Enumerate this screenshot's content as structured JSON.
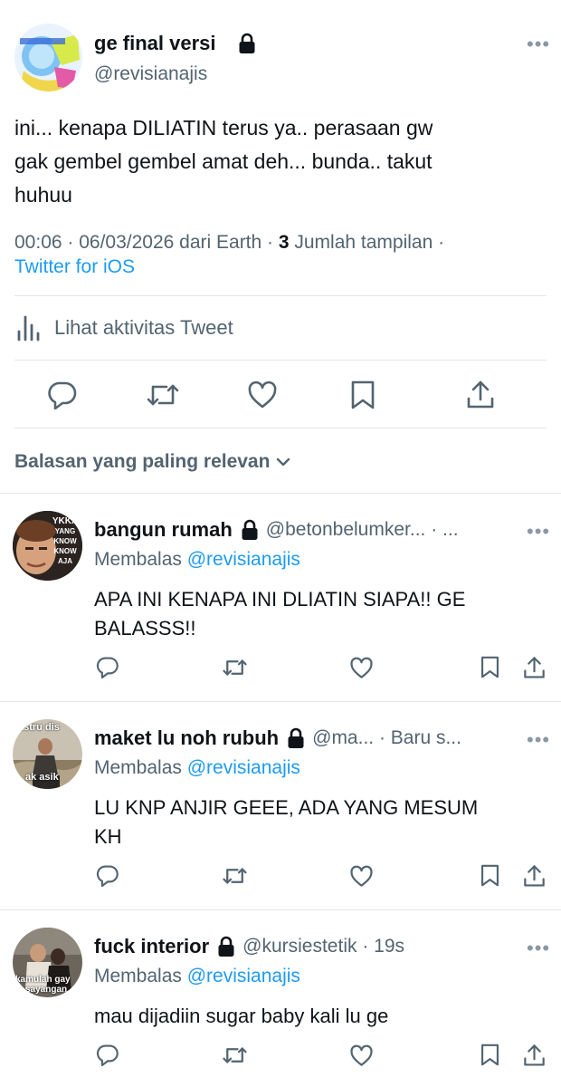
{
  "tweet": {
    "author_name": "ge final versi",
    "author_handle": "@revisianajis",
    "text_lines": [
      "ini... kenapa DILIATIN terus ya.. perasaan gw",
      "gak gembel gembel amat deh... bunda.. takut",
      "huhuu"
    ],
    "meta_time": "00:06 · 06/03/2026 dari Earth · ",
    "views_count": "3",
    "views_label": " Jumlah tampilan ·",
    "source": "Twitter for iOS",
    "activity_label": "Lihat aktivitas Tweet"
  },
  "sort": {
    "label": "Balasan yang paling relevan"
  },
  "replies": [
    {
      "name": "bangun rumah",
      "handle_time": "@betonbelumker... · ...",
      "replying_prefix": "Membalas",
      "replying_to": "@revisianajis",
      "text_lines": [
        "APA INI KENAPA INI DLIATIN SIAPA!! GE",
        "BALASSS!!"
      ],
      "avatar_text": [
        "YKKA",
        "YANG",
        "KNOW",
        "KNOW",
        "AJA"
      ]
    },
    {
      "name": "maket lu noh rubuh",
      "handle_time": "@ma... · Baru s...",
      "replying_prefix": "Membalas",
      "replying_to": "@revisianajis",
      "text_lines": [
        "LU KNP ANJIR GEEE, ADA YANG MESUM",
        "KH"
      ],
      "avatar_text": [
        "astru dis",
        "ak asik"
      ]
    },
    {
      "name": "fuck interior",
      "handle_time": "@kursiestetik · 19s",
      "replying_prefix": "Membalas",
      "replying_to": "@revisianajis",
      "text_lines": [
        "mau dijadiin sugar baby kali lu ge"
      ],
      "avatar_text": [
        "kamulah gay",
        "sayangan"
      ]
    }
  ],
  "colors": {
    "accent": "#1d9bf0",
    "text": "#0f1419",
    "muted": "#536471",
    "divider": "#e1e6ea"
  }
}
